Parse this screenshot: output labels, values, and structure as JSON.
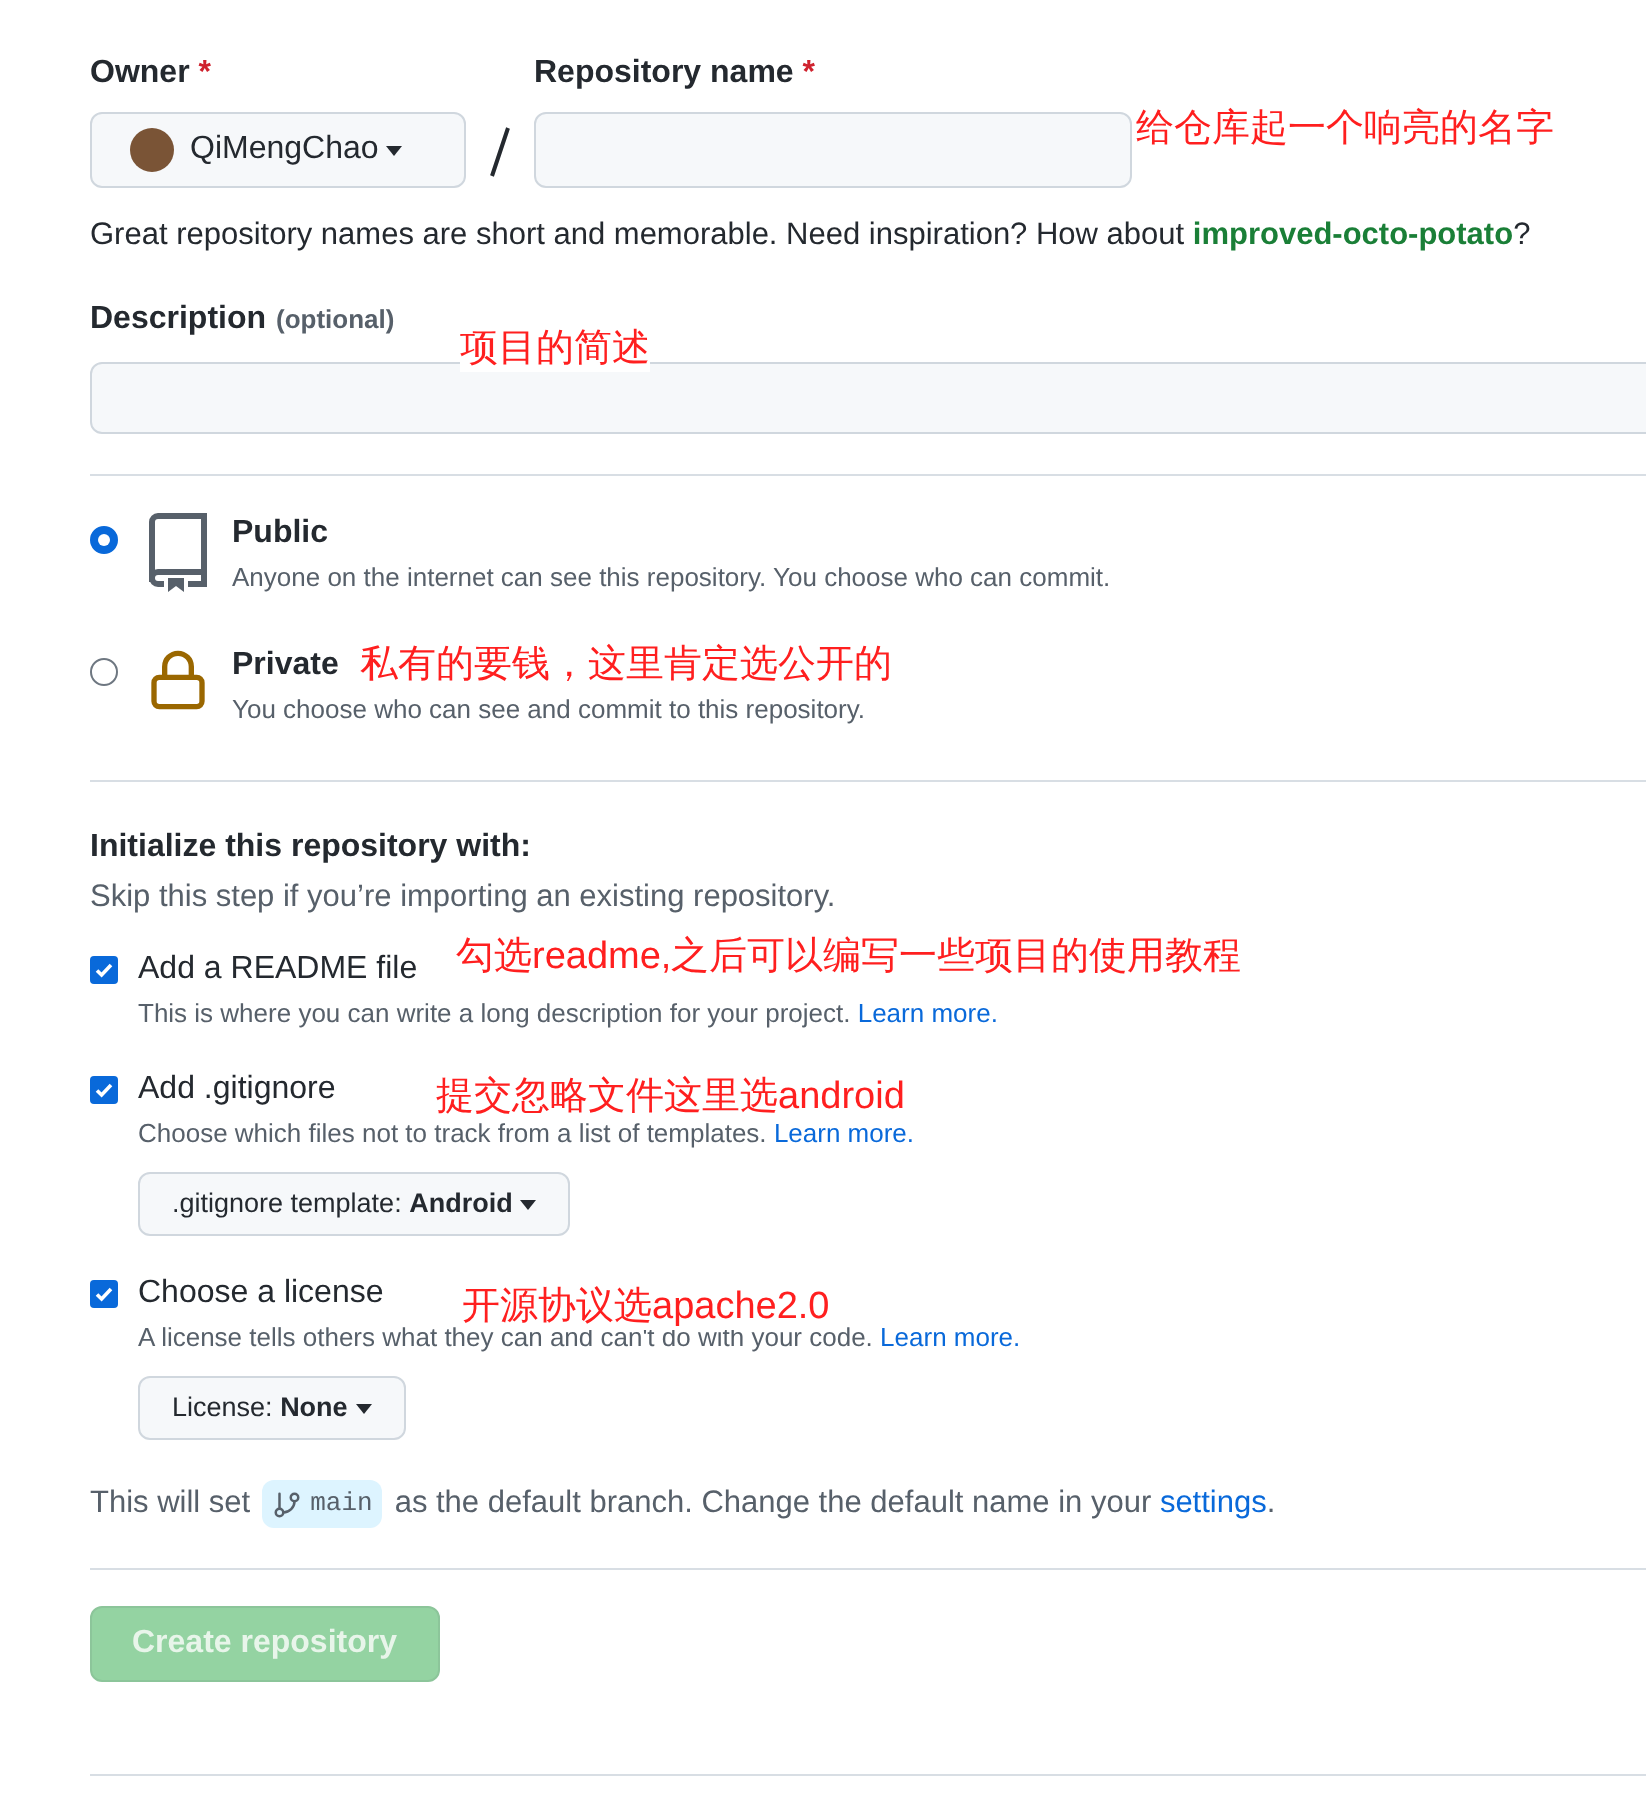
{
  "owner": {
    "label": "Owner",
    "required_mark": "*",
    "value": "QiMengChao"
  },
  "repository_name": {
    "label": "Repository name",
    "required_mark": "*"
  },
  "name_hint": {
    "text": "Great repository names are short and memorable. Need inspiration? How about",
    "suggestion": "improved-octo-potato",
    "end": "?"
  },
  "description": {
    "label": "Description",
    "optional": "(optional)"
  },
  "visibility": [
    {
      "kind": "public",
      "title": "Public",
      "subtitle": "Anyone on the internet can see this repository. You choose who can commit.",
      "selected": true
    },
    {
      "kind": "private",
      "title": "Private",
      "subtitle": "You choose who can see and commit to this repository.",
      "selected": false
    }
  ],
  "initialize": {
    "title": "Initialize this repository with:",
    "subtitle": "Skip this step if you’re importing an existing repository.",
    "options": [
      {
        "label": "Add a README file",
        "description": "This is where you can write a long description for your project.",
        "link": "Learn more.",
        "checked": true
      },
      {
        "label": "Add .gitignore",
        "description": "Choose which files not to track from a list of templates.",
        "link": "Learn more.",
        "checked": true,
        "dropdown": {
          "label": ".gitignore template:",
          "value": "Android"
        }
      },
      {
        "label": "Choose a license",
        "description": "A license tells others what they can and can't do with your code.",
        "link": "Learn more.",
        "checked": true,
        "dropdown": {
          "label": "License:",
          "value": "None"
        }
      }
    ]
  },
  "branch_note": {
    "before": "This will set",
    "branch": "main",
    "after": "as the default branch. Change the default name in your",
    "link": "settings",
    "end": "."
  },
  "create_button": {
    "label": "Create repository",
    "disabled": true
  },
  "annotations": [
    {
      "text": "给仓库起一个响亮的名字"
    },
    {
      "text": "项目的简述"
    },
    {
      "text": "私有的要钱，这里肯定选公开的"
    },
    {
      "text": "勾选readme,之后可以编写一些项目的使用教程"
    },
    {
      "text": "提交忽略文件这里选android"
    },
    {
      "text": "开源协议选apache2.0"
    }
  ]
}
